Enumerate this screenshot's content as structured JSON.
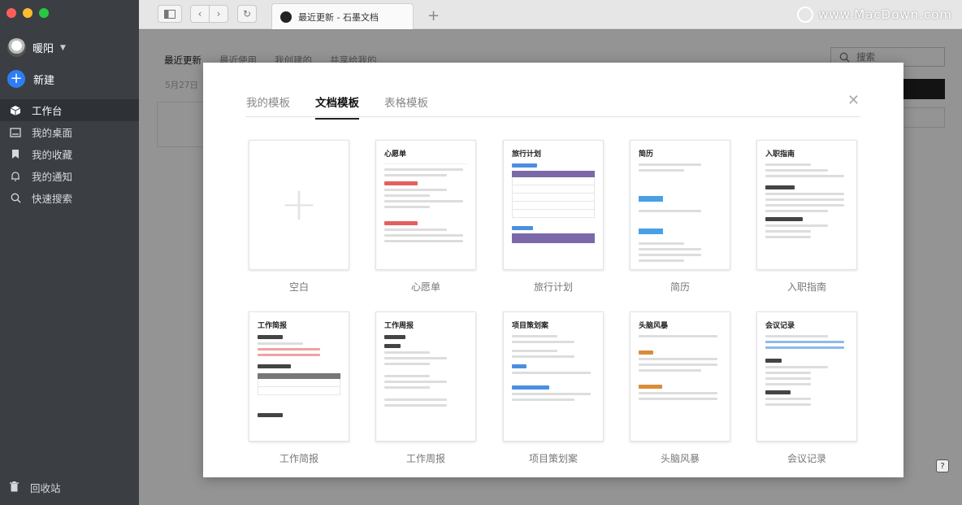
{
  "user": {
    "name": "暖阳"
  },
  "sidebar": {
    "new_label": "新建",
    "items": [
      {
        "label": "工作台",
        "icon": "cube-icon",
        "active": true
      },
      {
        "label": "我的桌面",
        "icon": "desktop-icon",
        "active": false
      },
      {
        "label": "我的收藏",
        "icon": "bookmark-icon",
        "active": false
      },
      {
        "label": "我的通知",
        "icon": "bell-icon",
        "active": false
      },
      {
        "label": "快速搜索",
        "icon": "search-icon",
        "active": false
      }
    ],
    "trash_label": "回收站"
  },
  "browser": {
    "tab_title": "最近更新 - 石墨文档",
    "new_tab_symbol": "+",
    "watermark": "www.MacDown.com"
  },
  "background": {
    "tabs": [
      "最近更新",
      "最近使用",
      "我创建的",
      "共享给我的"
    ],
    "date": "5月27日",
    "search_placeholder": "搜索"
  },
  "modal": {
    "tabs": [
      "我的模板",
      "文档模板",
      "表格模板"
    ],
    "active_tab": 1,
    "templates": [
      {
        "label": "空白",
        "title": ""
      },
      {
        "label": "心愿单",
        "title": "心愿单"
      },
      {
        "label": "旅行计划",
        "title": "旅行计划"
      },
      {
        "label": "简历",
        "title": "简历"
      },
      {
        "label": "入职指南",
        "title": "入职指南"
      },
      {
        "label": "工作简报",
        "title": "工作简报"
      },
      {
        "label": "工作周报",
        "title": "工作周报"
      },
      {
        "label": "项目策划案",
        "title": "项目策划案"
      },
      {
        "label": "头脑风暴",
        "title": "头脑风暴"
      },
      {
        "label": "会议记录",
        "title": "会议记录"
      }
    ]
  },
  "colors": {
    "sidebar_bg": "#3b3f44",
    "accent_blue": "#2f7df6",
    "purple": "#7b68a8"
  }
}
